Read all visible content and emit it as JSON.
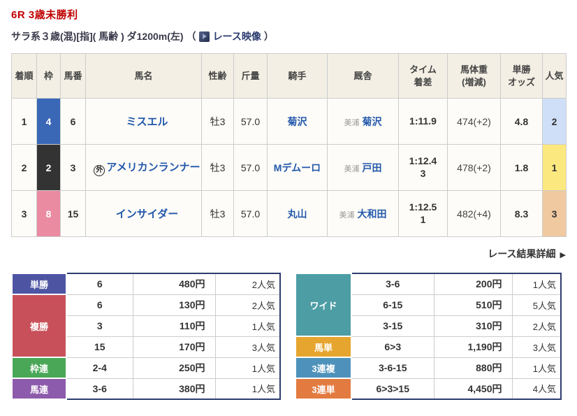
{
  "header": {
    "race_title": "6R 3歳未勝利",
    "race_conditions": "サラ系３歳(混)[指]( 馬齢 ) ダ1200m(左)",
    "paren_open": "（",
    "paren_close": "）",
    "video_link_label": "レース映像"
  },
  "results_table": {
    "head": {
      "finish": "着順",
      "bracket": "枠",
      "number": "馬番",
      "name": "馬名",
      "sex_age": "性齢",
      "carried": "斤量",
      "jockey": "騎手",
      "stable": "厩舎",
      "time_l1": "タイム",
      "time_l2": "着差",
      "hweight_l1": "馬体重",
      "hweight_l2": "(増減)",
      "odds_l1": "単勝",
      "odds_l2": "オッズ",
      "popularity": "人気"
    },
    "bracket_colors": {
      "2": "#333333",
      "4": "#3a68b7",
      "8": "#ea8ba2"
    },
    "popularity_colors": {
      "1": "#fbe97f",
      "2": "#cfdff8",
      "3": "#f1c9a1"
    },
    "rows": [
      {
        "finish": "1",
        "bracket": "4",
        "bracket_color": "#3a68b7",
        "number": "6",
        "foreign_mark": "",
        "name": "ミスエル",
        "sex_age": "牡3",
        "carried": "57.0",
        "jockey": "菊沢",
        "region": "美浦",
        "trainer": "菊沢",
        "time": "1:11.9",
        "margin": "",
        "horse_weight": "474(+2)",
        "odds": "4.8",
        "popularity": "2",
        "popularity_color": "#cfdff8"
      },
      {
        "finish": "2",
        "bracket": "2",
        "bracket_color": "#333333",
        "number": "3",
        "foreign_mark": "外",
        "name": "アメリカンランナー",
        "sex_age": "牡3",
        "carried": "57.0",
        "jockey": "Mデムーロ",
        "region": "美浦",
        "trainer": "戸田",
        "time": "1:12.4",
        "margin": "3",
        "horse_weight": "478(+2)",
        "odds": "1.8",
        "popularity": "1",
        "popularity_color": "#fbe97f"
      },
      {
        "finish": "3",
        "bracket": "8",
        "bracket_color": "#ea8ba2",
        "number": "15",
        "foreign_mark": "",
        "name": "インサイダー",
        "sex_age": "牡3",
        "carried": "57.0",
        "jockey": "丸山",
        "region": "美浦",
        "trainer": "大和田",
        "time": "1:12.5",
        "margin": "1",
        "horse_weight": "482(+4)",
        "odds": "8.3",
        "popularity": "3",
        "popularity_color": "#f1c9a1"
      }
    ]
  },
  "detail_link": {
    "label": "レース結果詳細",
    "arrow": "▶"
  },
  "payouts": {
    "border_color": "#2e3c6e",
    "left": {
      "tansho": {
        "label": "単勝",
        "color": "#4d55a3",
        "row": {
          "combo": "6",
          "payout": "480円",
          "ninki": "2人気"
        }
      },
      "fukusho": {
        "label": "複勝",
        "color": "#c8505a",
        "rows": [
          {
            "combo": "6",
            "payout": "130円",
            "ninki": "2人気"
          },
          {
            "combo": "3",
            "payout": "110円",
            "ninki": "1人気"
          },
          {
            "combo": "15",
            "payout": "170円",
            "ninki": "3人気"
          }
        ]
      },
      "wakuren": {
        "label": "枠連",
        "color": "#4aa757",
        "row": {
          "combo": "2-4",
          "payout": "250円",
          "ninki": "1人気"
        }
      },
      "umaren": {
        "label": "馬連",
        "color": "#8d5bab",
        "row": {
          "combo": "3-6",
          "payout": "380円",
          "ninki": "1人気"
        }
      }
    },
    "right": {
      "wide": {
        "label": "ワイド",
        "color": "#4d9da5",
        "rows": [
          {
            "combo": "3-6",
            "payout": "200円",
            "ninki": "1人気"
          },
          {
            "combo": "6-15",
            "payout": "510円",
            "ninki": "5人気"
          },
          {
            "combo": "3-15",
            "payout": "310円",
            "ninki": "2人気"
          }
        ]
      },
      "umatan": {
        "label": "馬単",
        "color": "#e6a52f",
        "row": {
          "combo": "6>3",
          "payout": "1,190円",
          "ninki": "3人気"
        }
      },
      "sanrenpuku": {
        "label": "3連複",
        "color": "#4e92bb",
        "row": {
          "combo": "3-6-15",
          "payout": "880円",
          "ninki": "1人気"
        }
      },
      "sanrentan": {
        "label": "3連単",
        "color": "#e37b41",
        "row": {
          "combo": "6>3>15",
          "payout": "4,450円",
          "ninki": "4人気"
        }
      }
    }
  }
}
